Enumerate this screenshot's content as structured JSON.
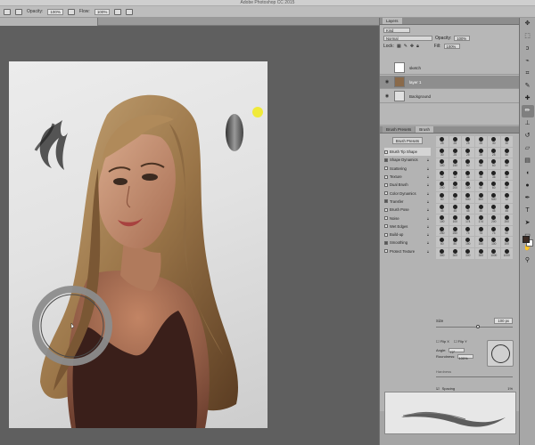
{
  "app": {
    "title": "Adobe Photoshop CC 2015"
  },
  "options_bar": {
    "opacity_label": "Opacity:",
    "opacity_value": "100%",
    "flow_label": "Flow:",
    "flow_value": "100%"
  },
  "document": {
    "tab_label": ""
  },
  "layers_panel": {
    "tab_label": "Layers",
    "filter_value": "Kind",
    "blend_mode": "Normal",
    "opacity_label": "Opacity:",
    "opacity_value": "100%",
    "lock_label": "Lock:",
    "fill_label": "Fill:",
    "fill_value": "100%",
    "layers": [
      {
        "name": "sketch",
        "visible": false
      },
      {
        "name": "layer 1",
        "visible": true,
        "selected": true
      },
      {
        "name": "Background",
        "visible": true
      }
    ]
  },
  "brush_panel": {
    "tabs": [
      {
        "label": "Brush Presets"
      },
      {
        "label": "Brush"
      }
    ],
    "presets_button": "Brush Presets",
    "options": [
      {
        "label": "Brush Tip Shape",
        "checked": false
      },
      {
        "label": "Shape Dynamics",
        "checked": true
      },
      {
        "label": "Scattering",
        "checked": false
      },
      {
        "label": "Texture",
        "checked": false
      },
      {
        "label": "Dual Brush",
        "checked": false
      },
      {
        "label": "Color Dynamics",
        "checked": false
      },
      {
        "label": "Transfer",
        "checked": true
      },
      {
        "label": "Brush Pose",
        "checked": false
      },
      {
        "label": "Noise",
        "checked": false
      },
      {
        "label": "Wet Edges",
        "checked": false
      },
      {
        "label": "Build-up",
        "checked": false
      },
      {
        "label": "Smoothing",
        "checked": true
      },
      {
        "label": "Protect Texture",
        "checked": false
      }
    ],
    "tip_sizes": [
      "25",
      "25",
      "25",
      "25",
      "30",
      "30",
      "30",
      "25",
      "25",
      "25",
      "25",
      "50",
      "100",
      "150",
      "60",
      "60",
      "60",
      "60",
      "12",
      "12",
      "36",
      "36",
      "36",
      "36",
      "200",
      "200",
      "100",
      "60",
      "60",
      "60",
      "60",
      "60",
      "500",
      "500",
      "500",
      "12",
      "45",
      "45",
      "45",
      "45",
      "45",
      "45",
      "100",
      "100",
      "174",
      "174",
      "200",
      "200",
      "250",
      "250",
      "74",
      "74",
      "74",
      "60",
      "60",
      "80",
      "150",
      "150",
      "100",
      "100",
      "300",
      "300",
      "300",
      "300",
      "1000",
      "1000"
    ],
    "size_label": "Size",
    "size_value": "100 px",
    "flip_x_label": "Flip X",
    "flip_y_label": "Flip Y",
    "angle_label": "Angle:",
    "angle_value": "72°",
    "roundness_label": "Roundness:",
    "roundness_value": "100%",
    "hardness_label": "Hardness",
    "spacing_label": "Spacing",
    "spacing_value": "1%"
  },
  "tools": [
    {
      "name": "move-tool",
      "glyph": "✥"
    },
    {
      "name": "marquee-tool",
      "glyph": "⬚"
    },
    {
      "name": "lasso-tool",
      "glyph": "ↄ"
    },
    {
      "name": "quick-select-tool",
      "glyph": "⌁"
    },
    {
      "name": "crop-tool",
      "glyph": "⌗"
    },
    {
      "name": "eyedropper-tool",
      "glyph": "✎"
    },
    {
      "name": "healing-tool",
      "glyph": "✚"
    },
    {
      "name": "brush-tool",
      "glyph": "✏",
      "active": true
    },
    {
      "name": "clone-stamp-tool",
      "glyph": "⊥"
    },
    {
      "name": "history-brush-tool",
      "glyph": "↺"
    },
    {
      "name": "eraser-tool",
      "glyph": "▱"
    },
    {
      "name": "gradient-tool",
      "glyph": "▤"
    },
    {
      "name": "blur-tool",
      "glyph": "◖"
    },
    {
      "name": "dodge-tool",
      "glyph": "●"
    },
    {
      "name": "pen-tool",
      "glyph": "✒"
    },
    {
      "name": "type-tool",
      "glyph": "T"
    },
    {
      "name": "path-select-tool",
      "glyph": "➤"
    },
    {
      "name": "shape-tool",
      "glyph": "▭"
    },
    {
      "name": "hand-tool",
      "glyph": "✋"
    },
    {
      "name": "zoom-tool",
      "glyph": "⚲"
    }
  ],
  "colors": {
    "foreground": "#3b2a22",
    "background": "#ffffff",
    "accent_yellow": "#f0ea3a"
  }
}
